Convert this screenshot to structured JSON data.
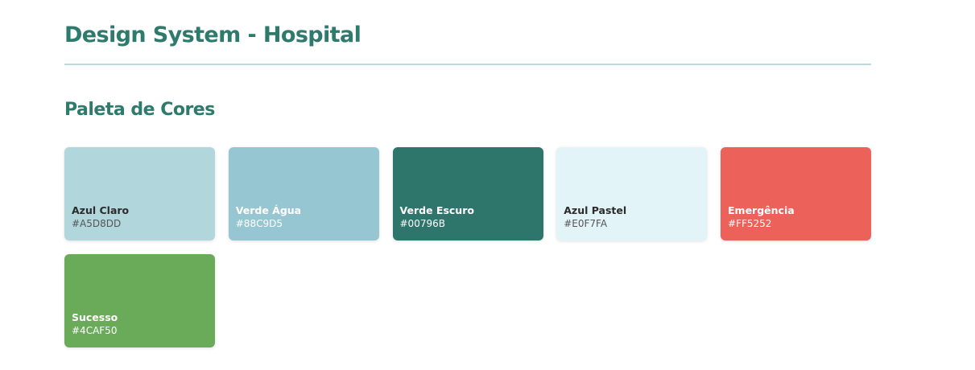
{
  "header": {
    "title": "Design System - Hospital"
  },
  "palette": {
    "section_title": "Paleta de Cores",
    "swatches": [
      {
        "name": "Azul Claro",
        "hex_label": "#A5D8DD",
        "color": "#b1d7dd",
        "text_tone": "dark"
      },
      {
        "name": "Verde Água",
        "hex_label": "#88C9D5",
        "color": "#96c6d2",
        "text_tone": "light"
      },
      {
        "name": "Verde Escuro",
        "hex_label": "#00796B",
        "color": "#2e766b",
        "text_tone": "light"
      },
      {
        "name": "Azul Pastel",
        "hex_label": "#E0F7FA",
        "color": "#e3f4f9",
        "text_tone": "dark"
      },
      {
        "name": "Emergência",
        "hex_label": "#FF5252",
        "color": "#ed615b",
        "text_tone": "light"
      },
      {
        "name": "Sucesso",
        "hex_label": "#4CAF50",
        "color": "#6aab5a",
        "text_tone": "light"
      }
    ]
  }
}
